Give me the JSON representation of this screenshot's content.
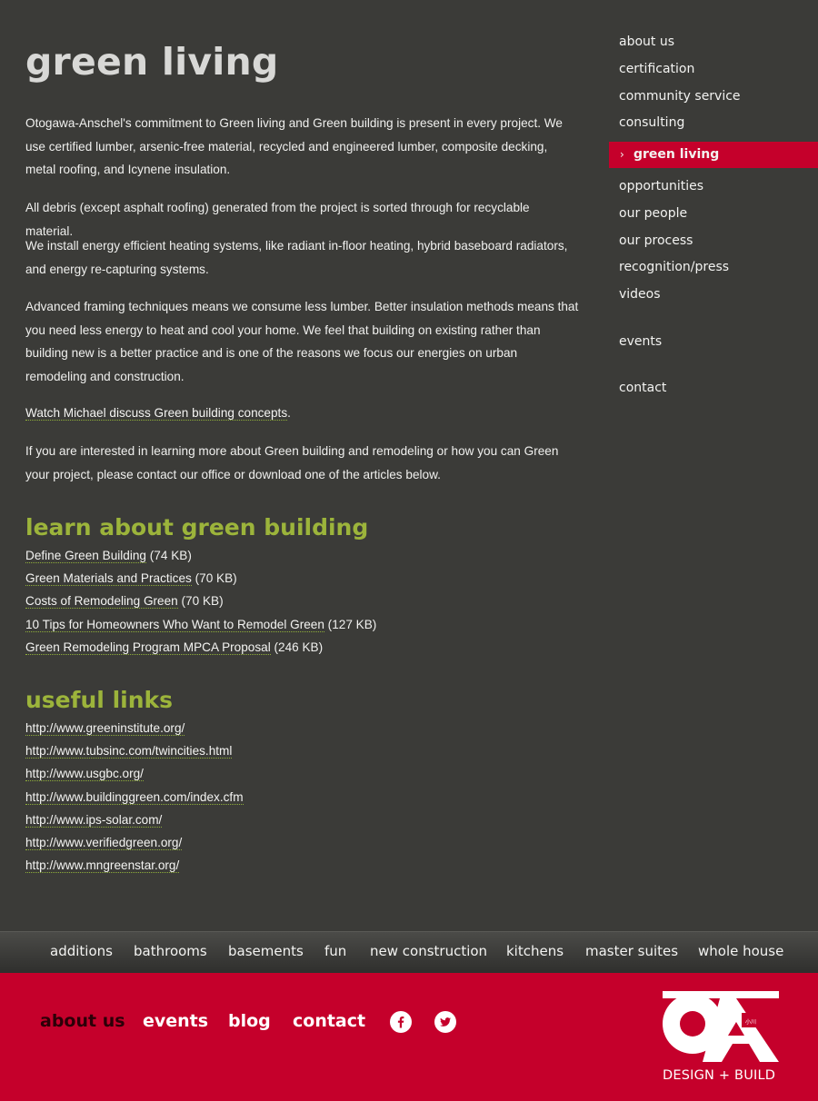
{
  "main": {
    "title": "green living",
    "paragraphs": [
      "Otogawa-Anschel's commitment to Green living and Green building is present in every project. We use certified lumber, arsenic-free material, recycled and engineered lumber, composite decking, metal roofing, and Icynene insulation.",
      "All debris (except asphalt roofing) generated from the project is sorted through for recyclable material.",
      "We install energy efficient heating systems, like radiant in-floor heating, hybrid baseboard radiators, and energy re-capturing systems.",
      "Advanced framing techniques means we consume less lumber. Better insulation methods means that you need less energy to heat and cool your home. We feel that building on existing rather than building new is a better practice and is one of the reasons we focus our energies on urban remodeling and construction."
    ],
    "watch_link": "Watch Michael discuss Green building concepts",
    "watch_suffix": ".",
    "contact_paragraph": "If you are interested in learning more about Green building and remodeling or how you can Green your project, please contact our office or download one of the articles below."
  },
  "learn": {
    "title": "learn about green building",
    "articles": [
      {
        "label": "Define Green Building",
        "size": " (74 KB)"
      },
      {
        "label": "Green Materials and Practices",
        "size": " (70 KB)"
      },
      {
        "label": "Costs of Remodeling Green",
        "size": " (70 KB)"
      },
      {
        "label": "10 Tips for Homeowners Who Want to Remodel Green",
        "size": " (127 KB)"
      },
      {
        "label": "Green Remodeling Program MPCA Proposal",
        "size": " (246 KB)"
      }
    ]
  },
  "useful": {
    "title": "useful links",
    "links": [
      "http://www.greeninstitute.org/",
      "http://www.tubsinc.com/twincities.html",
      "http://www.usgbc.org/",
      "http://www.buildinggreen.com/index.cfm",
      "http://www.ips-solar.com/",
      "http://www.verifiedgreen.org/",
      "http://www.mngreenstar.org/"
    ]
  },
  "sidebar": {
    "items": [
      {
        "label": "about us"
      },
      {
        "label": "certification"
      },
      {
        "label": "community service"
      },
      {
        "label": "consulting"
      },
      {
        "label": "green living",
        "active": true
      },
      {
        "label": "opportunities"
      },
      {
        "label": "our people"
      },
      {
        "label": "our process"
      },
      {
        "label": "recognition/press"
      },
      {
        "label": "videos"
      },
      {
        "label": "events"
      },
      {
        "label": "contact"
      }
    ]
  },
  "categories": [
    "additions",
    "bathrooms",
    "basements",
    "fun",
    "new construction",
    "kitchens",
    "master suites",
    "whole house"
  ],
  "footer": {
    "links": [
      "about us",
      "events",
      "blog",
      "contact"
    ],
    "logo_text": "DESIGN + BUILD"
  },
  "colors": {
    "background": "#3b3b38",
    "accent_red": "#c5002b",
    "heading_green": "#9cb43b",
    "title_gray": "#d8d8d6"
  },
  "icons": {
    "active_marker": "chevron-right-icon",
    "social": [
      "facebook-icon",
      "twitter-icon"
    ]
  }
}
